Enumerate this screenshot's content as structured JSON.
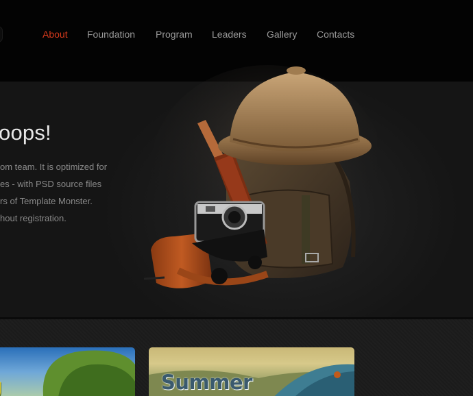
{
  "nav": {
    "items": [
      {
        "label": "About",
        "active": true
      },
      {
        "label": "Foundation",
        "active": false
      },
      {
        "label": "Program",
        "active": false
      },
      {
        "label": "Leaders",
        "active": false
      },
      {
        "label": "Gallery",
        "active": false
      },
      {
        "label": "Contacts",
        "active": false
      }
    ]
  },
  "hero": {
    "title": "oops!",
    "lines": [
      "om team. It is optimized for",
      "es - with PSD source files",
      "rs of Template Monster.",
      "hout registration."
    ]
  },
  "cards": {
    "first_title": "g",
    "second_title": "Summer"
  },
  "colors": {
    "accent": "#d5391c",
    "nav_text": "#9a9a9a",
    "background": "#030303"
  }
}
